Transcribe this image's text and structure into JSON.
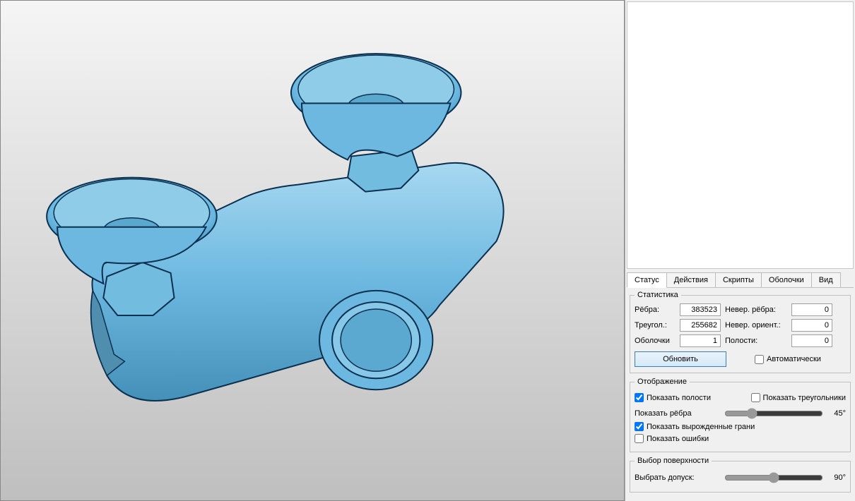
{
  "tabs": {
    "status": "Статус",
    "actions": "Действия",
    "scripts": "Скрипты",
    "shells": "Оболочки",
    "view": "Вид"
  },
  "statistics": {
    "legend": "Статистика",
    "edges_label": "Рёбра:",
    "edges_value": "383523",
    "triangles_label": "Треугол.:",
    "triangles_value": "255682",
    "shells_label": "Оболочки",
    "shells_value": "1",
    "bad_edges_label": "Невер. рёбра:",
    "bad_edges_value": "0",
    "bad_orient_label": "Невер. ориент.:",
    "bad_orient_value": "0",
    "cavities_label": "Полости:",
    "cavities_value": "0",
    "update_button": "Обновить",
    "auto_label": "Автоматически",
    "auto_checked": false
  },
  "display": {
    "legend": "Отображение",
    "show_cavities_label": "Показать полости",
    "show_cavities_checked": true,
    "show_triangles_label": "Показать треугольники",
    "show_triangles_checked": false,
    "show_edges_label": "Показать рёбра",
    "show_edges_value": "45°",
    "show_degenerate_label": "Показать вырожденные грани",
    "show_degenerate_checked": true,
    "show_errors_label": "Показать ошибки",
    "show_errors_checked": false
  },
  "surface_select": {
    "legend": "Выбор поверхности",
    "tolerance_label": "Выбрать допуск:",
    "tolerance_value": "90°"
  }
}
